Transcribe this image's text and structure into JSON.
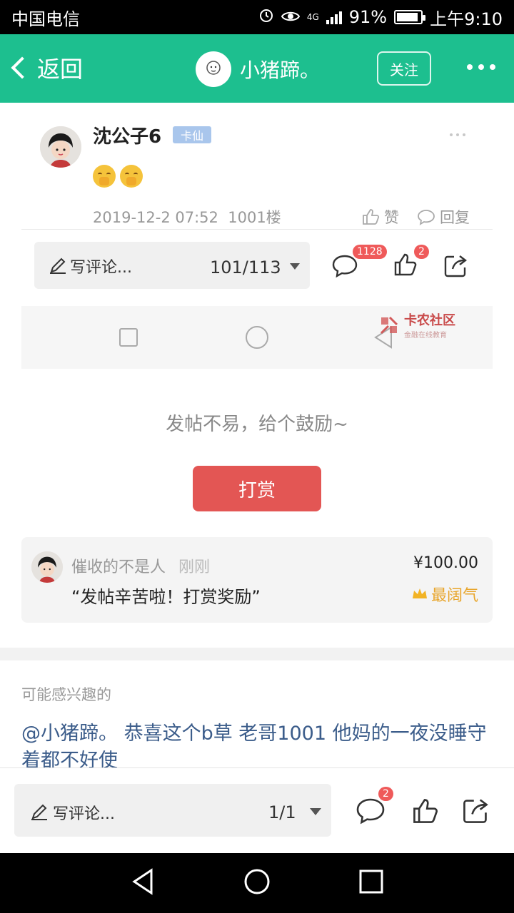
{
  "status_bar": {
    "carrier": "中国电信",
    "network": "4G",
    "battery": "91%",
    "battery_level": 0.91,
    "time": "上午9:10"
  },
  "header": {
    "back_label": "返回",
    "title": "小猪蹄。",
    "follow_label": "关注"
  },
  "screenshot": {
    "username": "沈公子6",
    "badge": "卡仙",
    "post_date": "2019-12-2 07:52",
    "floor": "1001楼",
    "like_label": "赞",
    "reply_label": "回复",
    "write_label": "写评论...",
    "page_indicator": "101/113",
    "comment_count": "1128",
    "like_count": "2",
    "watermark_name": "卡农社区",
    "watermark_sub": "金融在线教育"
  },
  "encourage_text": "发帖不易，给个鼓励~",
  "reward_button": "打赏",
  "tip": {
    "user": "催收的不是人",
    "time": "刚刚",
    "message": "“发帖辛苦啦！打赏奖励”",
    "amount": "¥100.00",
    "tag": "最阔气"
  },
  "interest": {
    "label": "可能感兴趣的",
    "title": "@小猪蹄。 恭喜这个b草 老哥1001 他妈的一夜没睡守着都不好使"
  },
  "bottom_bar": {
    "write_label": "写评论...",
    "page_indicator": "1/1",
    "comment_badge": "2"
  },
  "colors": {
    "header_green": "#1dbf8f",
    "reward_red": "#e35654",
    "badge_red": "#ef5a5a",
    "link_blue": "#3b5c8a",
    "gold": "#e8a52a"
  }
}
